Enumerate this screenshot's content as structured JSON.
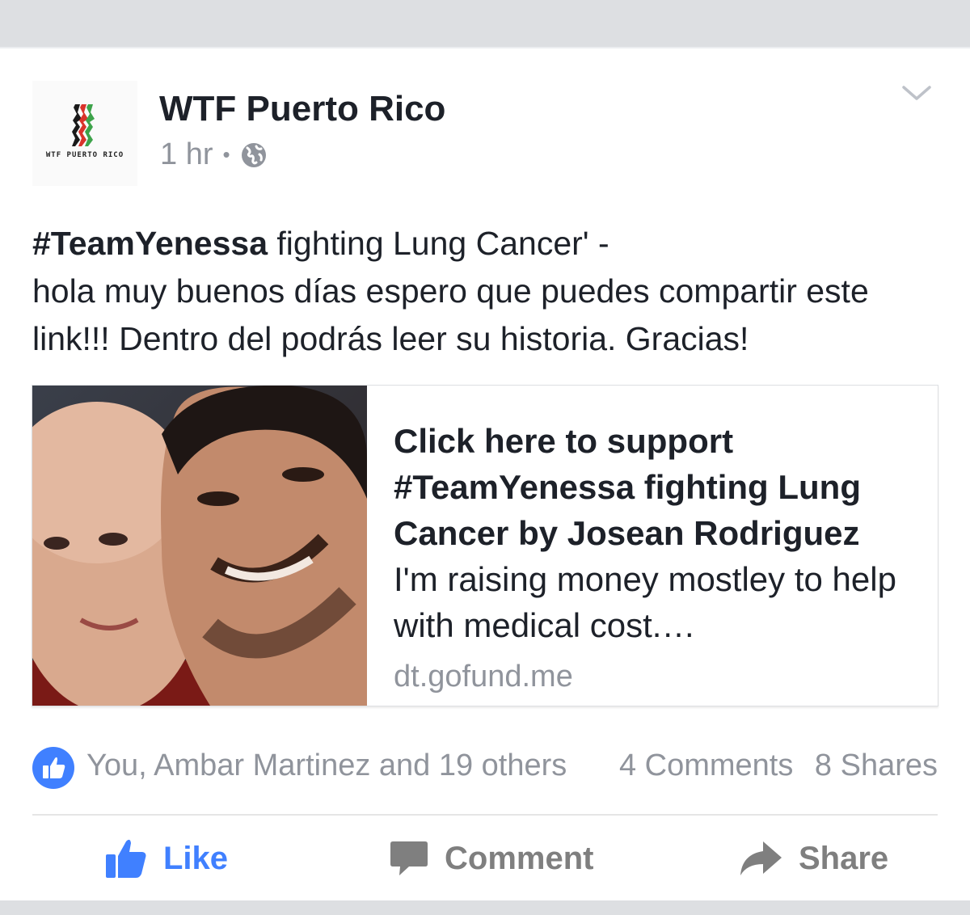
{
  "post": {
    "page_name": "WTF Puerto Rico",
    "logo_text": "WTF PUERTO RICO",
    "time": "1 hr",
    "separator": "•",
    "privacy_icon": "globe-icon",
    "menu_icon": "chevron-down-icon",
    "text_hashtag": "#TeamYenessa",
    "text_line1_rest": " fighting Lung Cancer' -",
    "text_body": "hola muy buenos días espero que puedes compartir este link!!! Dentro del podrás leer su historia. Gracias!"
  },
  "link": {
    "title": "Click here to support #TeamYenessa fighting Lung Cancer by Josean Rodriguez",
    "description": "I'm raising money mostley to help with medical cost.…",
    "domain": "dt.gofund.me"
  },
  "reactions": {
    "icon": "thumbs-up-icon",
    "text": "You, Ambar Martinez and 19 others",
    "comments": "4 Comments",
    "shares": "8 Shares"
  },
  "actions": {
    "like": "Like",
    "comment": "Comment",
    "share": "Share"
  },
  "colors": {
    "accent": "#4080ff",
    "text": "#1d2129",
    "meta": "#90949c",
    "background_gray": "#dddfe2"
  }
}
